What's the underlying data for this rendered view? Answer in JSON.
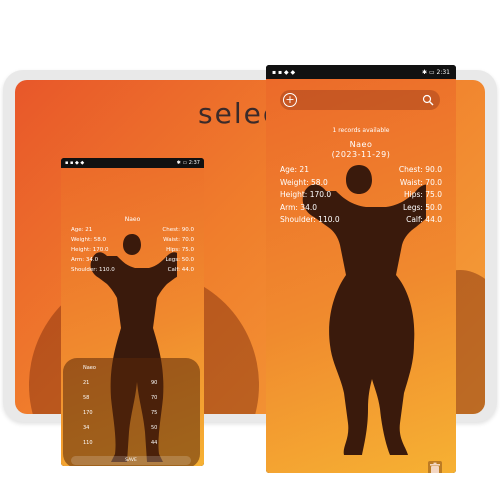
{
  "tablet": {
    "title": "selec"
  },
  "left_phone": {
    "status": {
      "left": "▪ ▪ ◆ ◆",
      "right": "✱ ▭ 2:37"
    },
    "name": "Naeo",
    "stats_left": [
      "Age: 21",
      "Weight: 58.0",
      "Height: 170.0",
      "Arm: 34.0",
      "Shoulder: 110.0"
    ],
    "stats_right": [
      "Chest: 90.0",
      "Waist: 70.0",
      "Hips: 75.0",
      "Legs: 50.0",
      "Calf: 44.0"
    ],
    "panel": {
      "header": "Naeo",
      "col1": [
        "21",
        "58",
        "170",
        "34",
        "110"
      ],
      "col2": [
        "90",
        "70",
        "75",
        "50",
        "44"
      ],
      "save_label": "SAVE"
    }
  },
  "right_phone": {
    "status": {
      "left": "▪ ▪ ◆ ◆",
      "right": "✱ ▭ 2:31"
    },
    "search": {
      "placeholder": ""
    },
    "records": "1 records available",
    "name": "Naeo",
    "date": "(2023-11-29)",
    "stats_left": [
      "Age: 21",
      "Weight: 58.0",
      "Height: 170.0",
      "Arm: 34.0",
      "Shoulder: 110.0"
    ],
    "stats_right": [
      "Chest: 90.0",
      "Waist: 70.0",
      "Hips: 75.0",
      "Legs: 50.0",
      "Calf: 44.0"
    ]
  },
  "colors": {
    "accent": "#f07e2c",
    "silhouette": "#3a1a0c"
  },
  "icons": [
    "plus-icon",
    "search-icon",
    "trash-icon",
    "bodybuilder-silhouette-icon"
  ]
}
